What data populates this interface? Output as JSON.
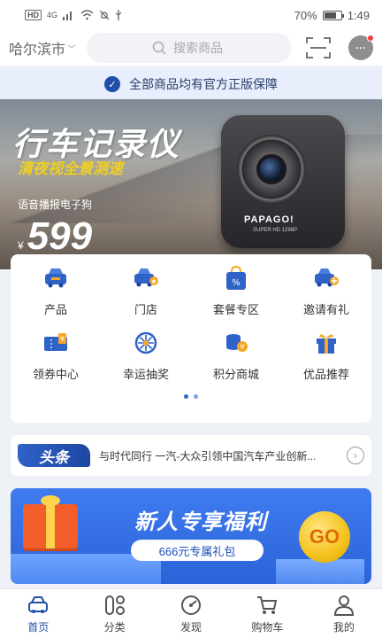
{
  "status_bar": {
    "network": "HD",
    "signal": "4G",
    "battery_percent": "70%",
    "battery_level": 0.7,
    "time": "1:49"
  },
  "header": {
    "city": "哈尔滨市",
    "search_placeholder": "搜索商品"
  },
  "guarantee": {
    "text": "全部商品均有官方正版保障"
  },
  "banner": {
    "title": "行车记录仪",
    "subtitle": "清夜视全景测速",
    "feature": "语音播报电子狗",
    "currency": "¥",
    "price": "599",
    "brand": "PAPAGO!",
    "model": "SUPER HD 1296P"
  },
  "features": [
    {
      "label": "产品",
      "icon": "car-product-icon"
    },
    {
      "label": "门店",
      "icon": "car-store-icon"
    },
    {
      "label": "套餐专区",
      "icon": "package-bag-icon"
    },
    {
      "label": "邀请有礼",
      "icon": "car-invite-icon"
    },
    {
      "label": "领券中心",
      "icon": "coupon-icon"
    },
    {
      "label": "幸运抽奖",
      "icon": "lottery-wheel-icon"
    },
    {
      "label": "积分商城",
      "icon": "points-coins-icon"
    },
    {
      "label": "优品推荐",
      "icon": "gift-icon"
    }
  ],
  "news": {
    "tag": "头条",
    "text": "与时代同行 一汽-大众引领中国汽车产业创新..."
  },
  "promo": {
    "title": "新人专享福利",
    "subtitle": "666元专属礼包",
    "go": "GO"
  },
  "tabs": [
    {
      "label": "首页",
      "icon": "home-car-icon",
      "active": true
    },
    {
      "label": "分类",
      "icon": "category-icon",
      "active": false
    },
    {
      "label": "发现",
      "icon": "discover-compass-icon",
      "active": false
    },
    {
      "label": "购物车",
      "icon": "cart-icon",
      "active": false
    },
    {
      "label": "我的",
      "icon": "profile-icon",
      "active": false
    }
  ],
  "colors": {
    "brand_blue": "#1f4fa8",
    "accent_orange": "#f5a623",
    "badge_red": "#f23a3a"
  }
}
